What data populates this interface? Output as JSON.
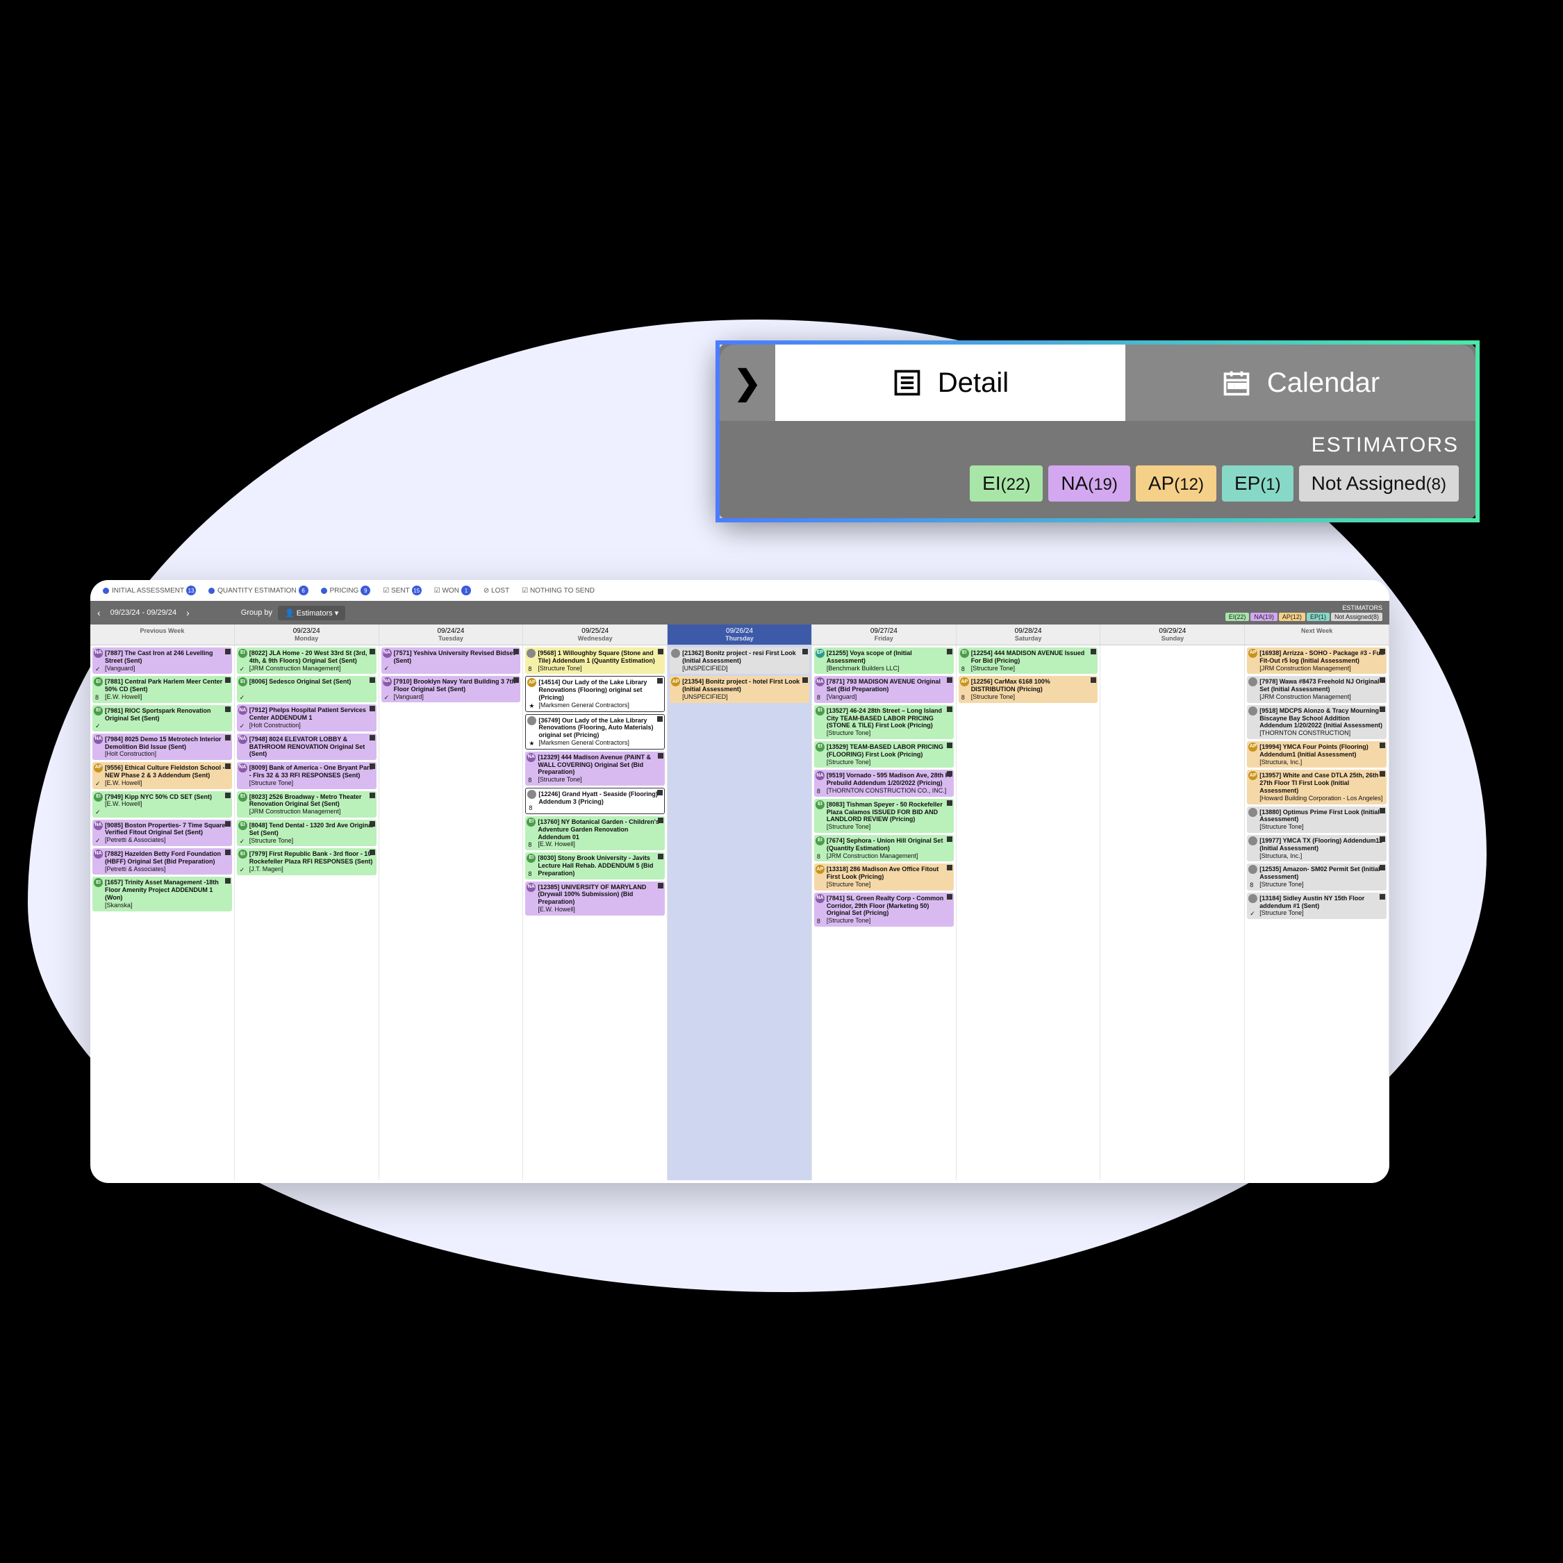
{
  "mag": {
    "detail": "Detail",
    "calendar": "Calendar",
    "label": "ESTIMATORS",
    "chips": [
      {
        "code": "EI",
        "count": "(22)",
        "cls": "c-ei"
      },
      {
        "code": "NA",
        "count": "(19)",
        "cls": "c-na"
      },
      {
        "code": "AP",
        "count": "(12)",
        "cls": "c-ap"
      },
      {
        "code": "EP",
        "count": "(1)",
        "cls": "c-ep"
      },
      {
        "code": "Not Assigned",
        "count": "(8)",
        "cls": "c-un"
      }
    ]
  },
  "filters": [
    {
      "label": "INITIAL ASSESSMENT",
      "count": "13",
      "dot": "#3b5bdb"
    },
    {
      "label": "QUANTITY ESTIMATION",
      "count": "6",
      "dot": "#3b5bdb"
    },
    {
      "label": "PRICING",
      "count": "9",
      "dot": "#3b5bdb"
    },
    {
      "label": "SENT",
      "count": "15",
      "dot": "#3b5bdb",
      "check": true
    },
    {
      "label": "WON",
      "count": "1",
      "dot": "#3b5bdb",
      "check": true
    },
    {
      "label": "LOST",
      "count": "",
      "dot": "#999",
      "x": true
    },
    {
      "label": "NOTHING TO SEND",
      "count": "",
      "dot": "#999",
      "check": true
    }
  ],
  "bar": {
    "range": "09/23/24 - 09/29/24",
    "groupby": "Group by",
    "estimators": "Estimators",
    "estlabel": "ESTIMATORS",
    "chips": [
      {
        "t": "EI(22)",
        "c": "c-ei"
      },
      {
        "t": "NA(19)",
        "c": "c-na"
      },
      {
        "t": "AP(12)",
        "c": "c-ap"
      },
      {
        "t": "EP(1)",
        "c": "c-ep"
      },
      {
        "t": "Not Assigned(8)",
        "c": "c-un"
      }
    ]
  },
  "cols": [
    {
      "date": "",
      "day": "Previous Week",
      "active": false
    },
    {
      "date": "09/23/24",
      "day": "Monday",
      "active": false
    },
    {
      "date": "09/24/24",
      "day": "Tuesday",
      "active": false
    },
    {
      "date": "09/25/24",
      "day": "Wednesday",
      "active": false
    },
    {
      "date": "09/26/24",
      "day": "Thursday",
      "active": true
    },
    {
      "date": "09/27/24",
      "day": "Friday",
      "active": false
    },
    {
      "date": "09/28/24",
      "day": "Saturday",
      "active": false
    },
    {
      "date": "09/29/24",
      "day": "Sunday",
      "active": false
    },
    {
      "date": "",
      "day": "Next Week",
      "active": false
    }
  ],
  "cards": [
    [
      {
        "c": "c-purple",
        "b": "b-na",
        "t": "[7887] The Cast Iron at 246 Levelling Street (Sent)",
        "s": "[Vanguard]",
        "chk": "✓"
      },
      {
        "c": "c-green",
        "b": "b-ei",
        "t": "[7881] Central Park Harlem Meer Center 50% CD (Sent)",
        "s": "[E.W. Howell]",
        "chk": "8"
      },
      {
        "c": "c-green",
        "b": "b-ei",
        "t": "[7981] RIOC Sportspark Renovation Original Set (Sent)",
        "s": "",
        "chk": "✓"
      },
      {
        "c": "c-purple",
        "b": "b-na",
        "t": "[7984] 8025 Demo 15 Metrotech Interior Demolition Bid Issue (Sent)",
        "s": "[Holt Construction]",
        "chk": ""
      },
      {
        "c": "c-orange",
        "b": "b-ap",
        "t": "[9556] Ethical Culture Fieldston School - NEW Phase 2 & 3 Addendum (Sent)",
        "s": "[E.W. Howell]",
        "chk": "✓"
      },
      {
        "c": "c-green",
        "b": "b-ei",
        "t": "[7949] Kipp NYC 50% CD SET (Sent)",
        "s": "[E.W. Howell]",
        "chk": "✓"
      },
      {
        "c": "c-purple",
        "b": "b-na",
        "t": "[9085] Boston Properties- 7 Time Square Verified Fitout Original Set (Sent)",
        "s": "[Petretti & Associates]",
        "chk": "✓"
      },
      {
        "c": "c-purple",
        "b": "b-na",
        "t": "[7882] Hazelden Betty Ford Foundation (HBFF) Original Set (Bid Preparation)",
        "s": "[Petretti & Associates]",
        "chk": ""
      },
      {
        "c": "c-green",
        "b": "b-ei",
        "t": "[1657] Trinity Asset Management -18th Floor Amenity Project ADDENDUM 1 (Won)",
        "s": "[Skanska]",
        "chk": ""
      }
    ],
    [
      {
        "c": "c-green",
        "b": "b-ei",
        "t": "[8022] JLA Home - 20 West 33rd St (3rd, 4th, & 9th Floors) Original Set (Sent)",
        "s": "[JRM Construction Management]",
        "chk": "✓"
      },
      {
        "c": "c-green",
        "b": "b-ei",
        "t": "[8006] Sedesco Original Set (Sent)",
        "s": "",
        "chk": "✓"
      },
      {
        "c": "c-purple",
        "b": "b-na",
        "t": "[7912] Phelps Hospital Patient Services Center ADDENDUM 1",
        "s": "[Holt Construction]",
        "chk": "✓"
      },
      {
        "c": "c-purple",
        "b": "b-na",
        "t": "[7948] 8024 ELEVATOR LOBBY & BATHROOM RENOVATION Original Set (Sent)",
        "s": "",
        "chk": ""
      },
      {
        "c": "c-purple",
        "b": "b-na",
        "t": "[8009] Bank of America - One Bryant Park - Flrs 32 & 33 RFI RESPONSES (Sent)",
        "s": "[Structure Tone]",
        "chk": ""
      },
      {
        "c": "c-green",
        "b": "b-ei",
        "t": "[8023] 2526 Broadway - Metro Theater Renovation Original Set (Sent)",
        "s": "[JRM Construction Management]",
        "chk": ""
      },
      {
        "c": "c-green",
        "b": "b-ei",
        "t": "[8048] Tend Dental - 1320 3rd Ave Original Set (Sent)",
        "s": "[Structure Tone]",
        "chk": "✓"
      },
      {
        "c": "c-green",
        "b": "b-ei",
        "t": "[7979] First Republic Bank - 3rd floor - 10 Rockefeller Plaza RFI RESPONSES (Sent)",
        "s": "[J.T. Magen]",
        "chk": "✓"
      }
    ],
    [
      {
        "c": "c-purple",
        "b": "b-na",
        "t": "[7571] Yeshiva University Revised Bidset (Sent)",
        "s": "",
        "chk": "✓"
      },
      {
        "c": "c-purple",
        "b": "b-na",
        "t": "[7910] Brooklyn Navy Yard Building 3 7th Floor Original Set (Sent)",
        "s": "[Vanguard]",
        "chk": "✓"
      }
    ],
    [
      {
        "c": "c-yellow",
        "b": "b-un",
        "t": "[9568] 1 Willoughby Square (Stone and Tile) Addendum 1 (Quantity Estimation)",
        "s": "[Structure Tone]",
        "chk": "8"
      },
      {
        "c": "c-white",
        "b": "b-ap",
        "t": "[14514] Our Lady of the Lake Library Renovations (Flooring) original set (Pricing)",
        "s": "[Marksmen General Contractors]",
        "chk": "★"
      },
      {
        "c": "c-white",
        "b": "b-un",
        "t": "[36749] Our Lady of the Lake Library Renovations (Flooring, Auto Materials) original set (Pricing)",
        "s": "[Marksmen General Contractors]",
        "chk": "★"
      },
      {
        "c": "c-purple",
        "b": "b-na",
        "t": "[12329] 444 Madison Avenue (PAINT & WALL COVERING) Original Set (Bid Preparation)",
        "s": "[Structure Tone]",
        "chk": "8"
      },
      {
        "c": "c-white",
        "b": "b-un",
        "t": "[12246] Grand Hyatt - Seaside (Flooring) Addendum 3 (Pricing)",
        "s": "",
        "chk": "8"
      },
      {
        "c": "c-green",
        "b": "b-ei",
        "t": "[13760] NY Botanical Garden - Children's Adventure Garden Renovation Addendum 01",
        "s": "[E.W. Howell]",
        "chk": "8"
      },
      {
        "c": "c-green",
        "b": "b-ei",
        "t": "[8030] Stony Brook University - Javits Lecture Hall Rehab. ADDENDUM 5 (Bid Preparation)",
        "s": "",
        "chk": "8"
      },
      {
        "c": "c-purple",
        "b": "b-na",
        "t": "[12385] UNIVERSITY OF MARYLAND (Drywall 100% Submission) (Bid Preparation)",
        "s": "[E.W. Howell]",
        "chk": ""
      }
    ],
    [
      {
        "c": "c-gray",
        "b": "b-un",
        "t": "[21362] Bonitz project - resi First Look (Initial Assessment)",
        "s": "[UNSPECIFIED]",
        "chk": ""
      },
      {
        "c": "c-orange",
        "b": "b-ap",
        "t": "[21354] Bonitz project - hotel First Look (Initial Assessment)",
        "s": "[UNSPECIFIED]",
        "chk": ""
      }
    ],
    [
      {
        "c": "c-green",
        "b": "b-ep",
        "t": "[21255] Voya scope of (Initial Assessment)",
        "s": "[Benchmark Builders LLC]",
        "chk": ""
      },
      {
        "c": "c-purple",
        "b": "b-na",
        "t": "[7871] 793 MADISON AVENUE Original Set (Bid Preparation)",
        "s": "[Vanguard]",
        "chk": "8"
      },
      {
        "c": "c-green",
        "b": "b-ei",
        "t": "[13527] 46-24 28th Street – Long Island City TEAM-BASED LABOR PRICING (STONE & TILE) First Look (Pricing)",
        "s": "[Structure Tone]",
        "chk": ""
      },
      {
        "c": "c-green",
        "b": "b-ei",
        "t": "[13529] TEAM-BASED LABOR PRICING (FLOORING) First Look (Pricing)",
        "s": "[Structure Tone]",
        "chk": ""
      },
      {
        "c": "c-purple",
        "b": "b-na",
        "t": "[9519] Vornado - 595 Madison Ave, 28th Fl Prebuild Addendum 1/20/2022 (Pricing)",
        "s": "[THORNTON CONSTRUCTION CO., INC.]",
        "chk": "8"
      },
      {
        "c": "c-green",
        "b": "b-ei",
        "t": "[8083] Tishman Speyer - 50 Rockefeller Plaza Calamos ISSUED FOR BID AND LANDLORD REVIEW (Pricing)",
        "s": "[Structure Tone]",
        "chk": ""
      },
      {
        "c": "c-green",
        "b": "b-ei",
        "t": "[7674] Sephora - Union Hill Original Set (Quantity Estimation)",
        "s": "[JRM Construction Management]",
        "chk": "8"
      },
      {
        "c": "c-orange",
        "b": "b-ap",
        "t": "[13318] 286 Madison Ave Office Fitout First Look (Pricing)",
        "s": "[Structure Tone]",
        "chk": ""
      },
      {
        "c": "c-purple",
        "b": "b-na",
        "t": "[7841] SL Green Realty Corp - Common Corridor, 29th Floor (Marketing 50) Original Set (Pricing)",
        "s": "[Structure Tone]",
        "chk": "8"
      }
    ],
    [
      {
        "c": "c-green",
        "b": "b-ei",
        "t": "[12254] 444 MADISON AVENUE Issued For Bid (Pricing)",
        "s": "[Structure Tone]",
        "chk": "8"
      },
      {
        "c": "c-orange",
        "b": "b-ap",
        "t": "[12256] CarMax 6168 100% DISTRIBUTION (Pricing)",
        "s": "[Structure Tone]",
        "chk": "8"
      }
    ],
    [],
    [
      {
        "c": "c-orange",
        "b": "b-ap",
        "t": "[16938] Arrizza - SOHO - Package #3 - Full Fit-Out r5 log (Initial Assessment)",
        "s": "[JRM Construction Management]",
        "chk": ""
      },
      {
        "c": "c-gray",
        "b": "b-un",
        "t": "[7978] Wawa #8473 Freehold NJ Original Set (Initial Assessment)",
        "s": "[JRM Construction Management]",
        "chk": ""
      },
      {
        "c": "c-gray",
        "b": "b-un",
        "t": "[9518] MDCPS Alonzo & Tracy Mourning Biscayne Bay School Addition Addendum 1/20/2022 (Initial Assessment)",
        "s": "[THORNTON CONSTRUCTION]",
        "chk": ""
      },
      {
        "c": "c-orange",
        "b": "b-ap",
        "t": "[19994] YMCA Four Points (Flooring) Addendum1 (Initial Assessment)",
        "s": "[Structura, Inc.]",
        "chk": ""
      },
      {
        "c": "c-orange",
        "b": "b-ap",
        "t": "[13957] White and Case DTLA 25th, 26th 27th Floor TI First Look (Initial Assessment)",
        "s": "[Howard Building Corporation - Los Angeles]",
        "chk": ""
      },
      {
        "c": "c-gray",
        "b": "b-un",
        "t": "[13880] Optimus Prime First Look (Initial Assessment)",
        "s": "[Structure Tone]",
        "chk": ""
      },
      {
        "c": "c-gray",
        "b": "b-un",
        "t": "[19977] YMCA TX (Flooring) Addendum11 (Initial Assessment)",
        "s": "[Structura, Inc.]",
        "chk": ""
      },
      {
        "c": "c-gray",
        "b": "b-un",
        "t": "[12535] Amazon- SM02 Permit Set (Initial Assessment)",
        "s": "[Structure Tone]",
        "chk": "8"
      },
      {
        "c": "c-gray",
        "b": "b-un",
        "t": "[13184] Sidley Austin NY 15th Floor addendum #1 (Sent)",
        "s": "[Structure Tone]",
        "chk": "✓"
      }
    ]
  ]
}
